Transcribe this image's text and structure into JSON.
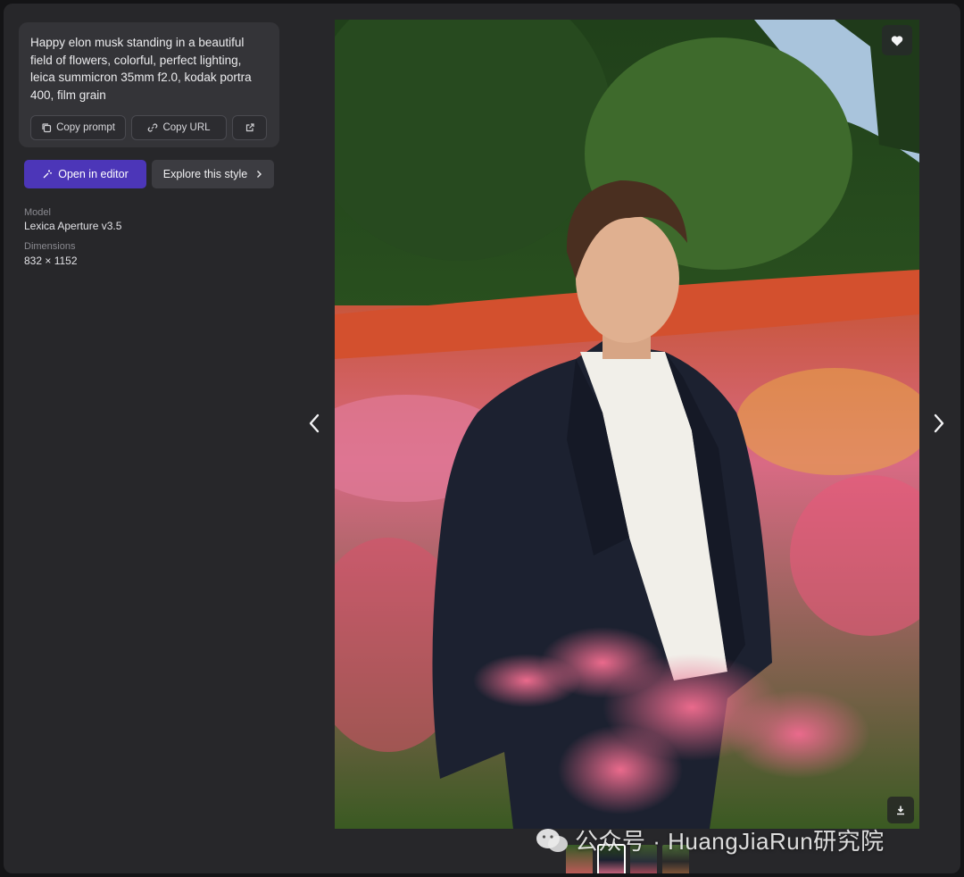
{
  "prompt": {
    "text": "Happy elon musk standing in a beautiful field of flowers, colorful, perfect lighting, leica summicron 35mm f2.0, kodak portra 400, film grain",
    "copy_prompt_label": "Copy prompt",
    "copy_url_label": "Copy URL"
  },
  "actions": {
    "open_editor_label": "Open in editor",
    "explore_style_label": "Explore this style"
  },
  "meta": {
    "model_label": "Model",
    "model_value": "Lexica Aperture v3.5",
    "dimensions_label": "Dimensions",
    "dimensions_value": "832 × 1152"
  },
  "image": {
    "icons": [
      "heart-icon",
      "download-icon",
      "chevron-left-icon",
      "chevron-right-icon"
    ]
  },
  "watermark": {
    "text": "公众号 · HuangJiaRun研究院"
  },
  "colors": {
    "accent": "#4c36b8",
    "panel": "#27272a",
    "card": "#343438"
  }
}
